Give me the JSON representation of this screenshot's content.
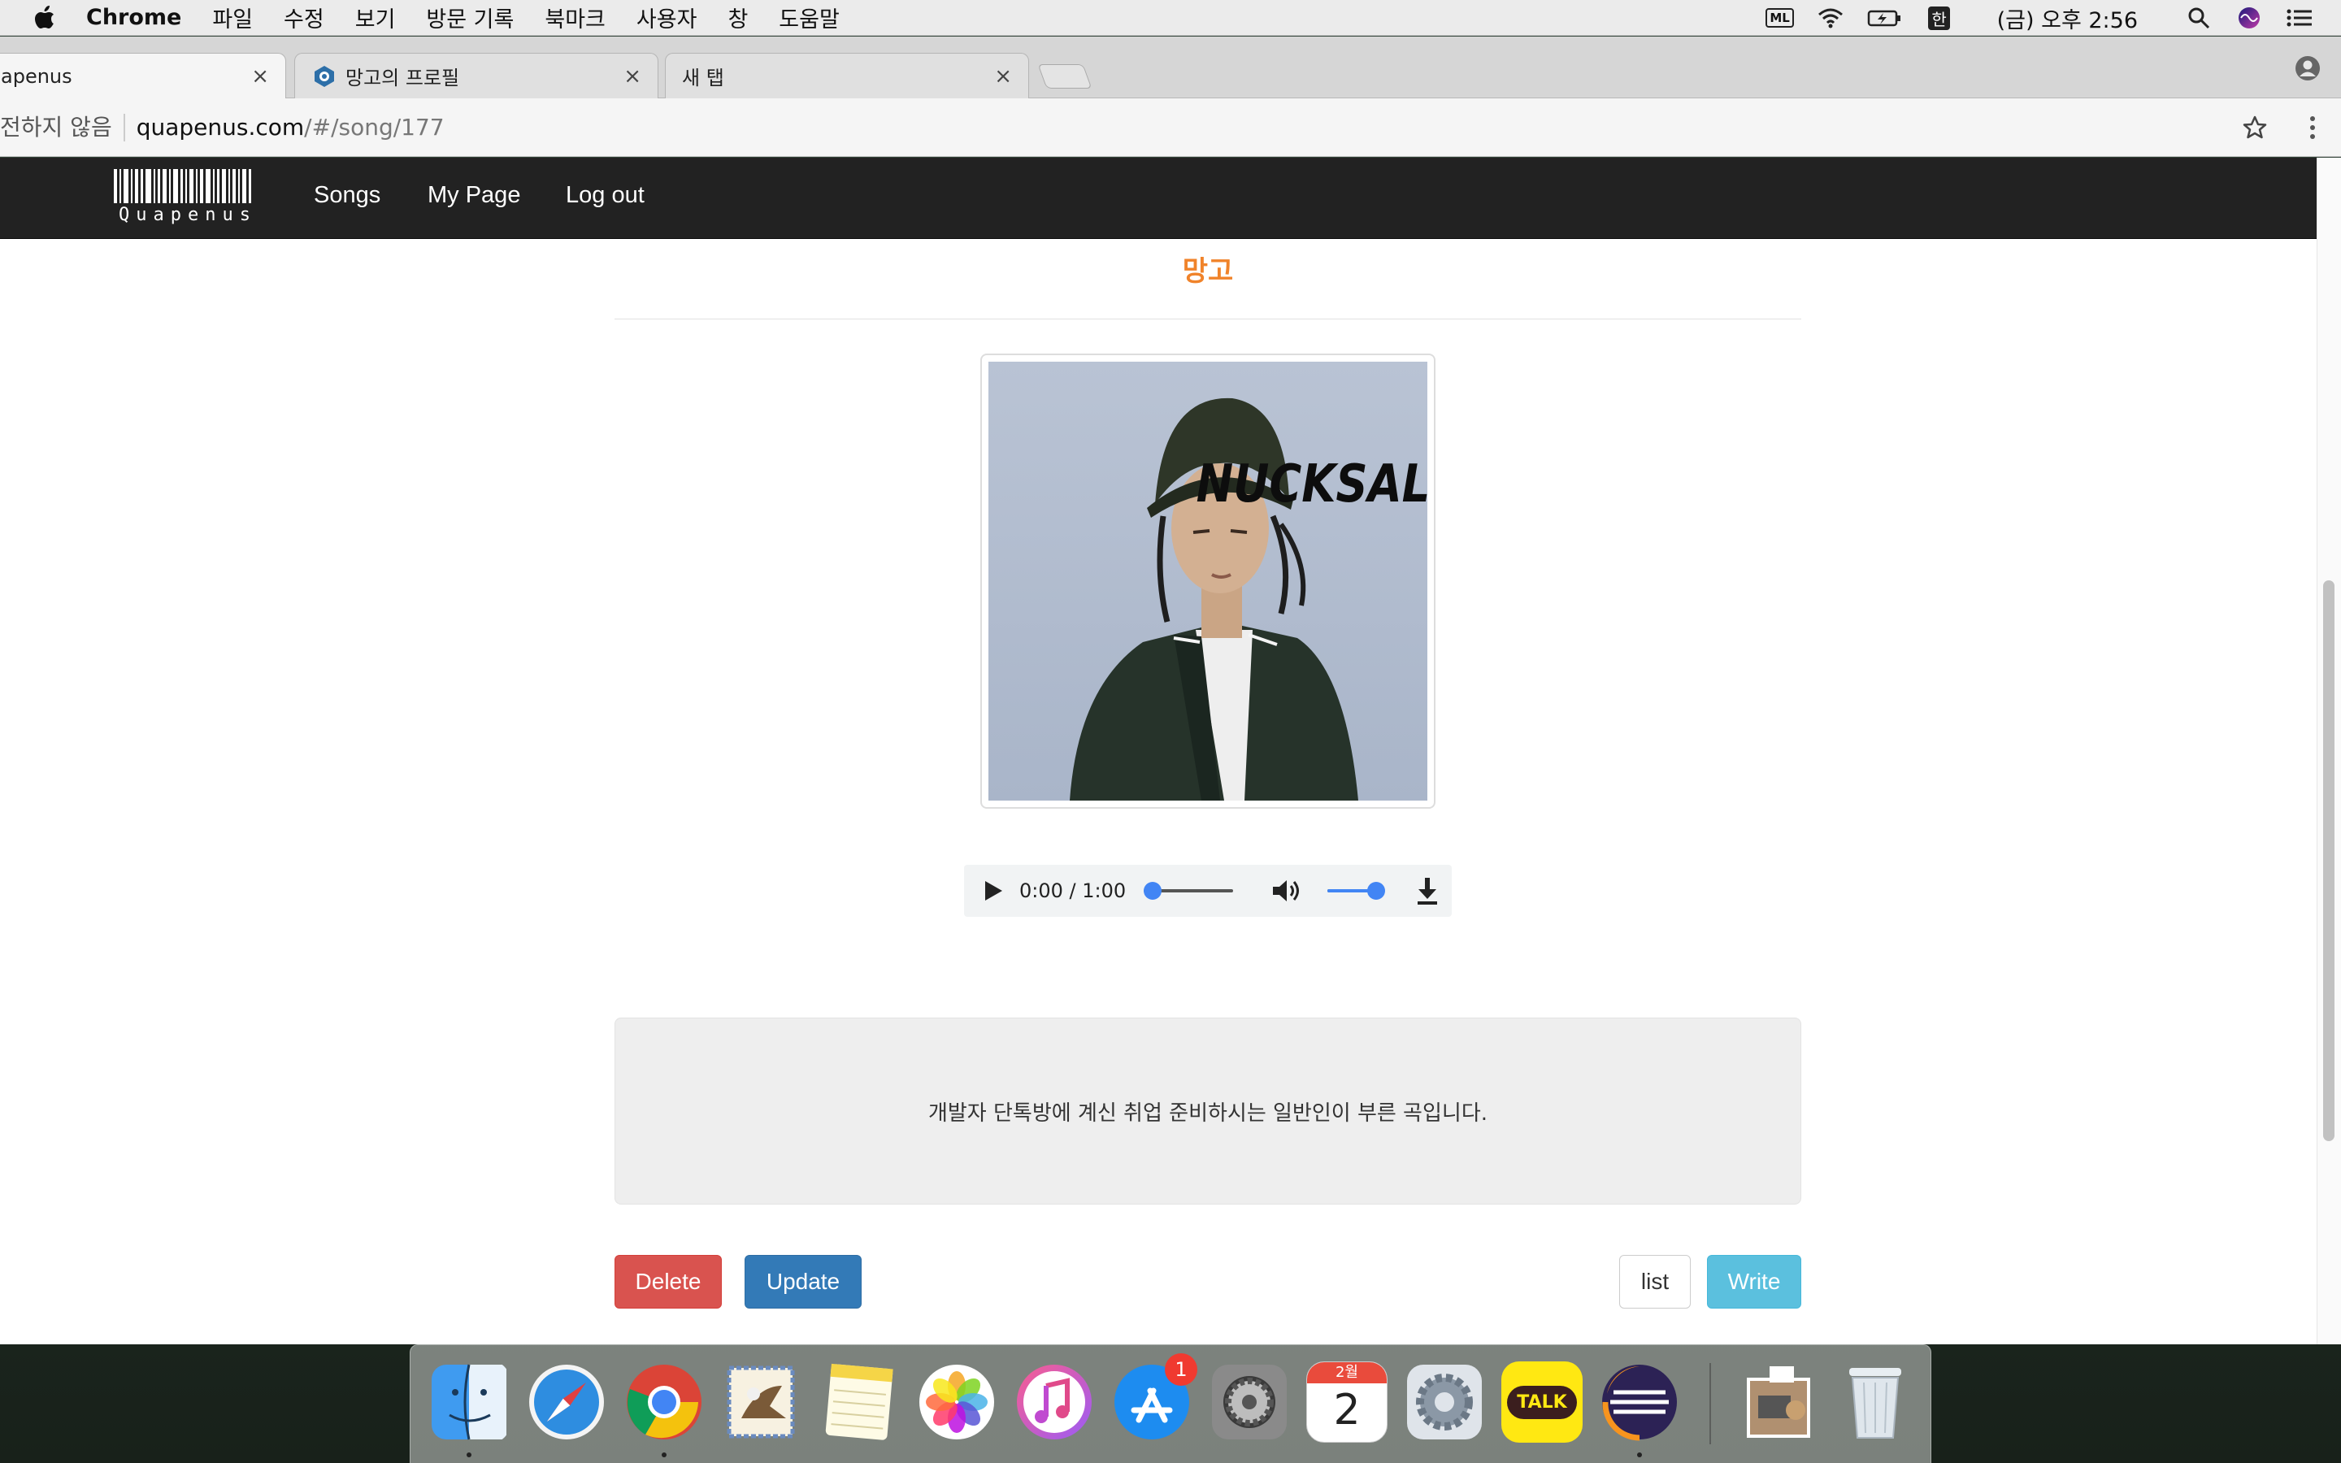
{
  "menubar": {
    "app_name": "Chrome",
    "items": [
      "파일",
      "수정",
      "보기",
      "방문 기록",
      "북마크",
      "사용자",
      "창",
      "도움말"
    ],
    "ml_label": "ML",
    "input_method": "한",
    "clock": "(금) 오후 2:56"
  },
  "tabs": [
    {
      "label": "apenus",
      "active": true
    },
    {
      "label": "망고의 프로필",
      "active": false
    },
    {
      "label": "새 탭",
      "active": false
    }
  ],
  "address": {
    "secure_note": "전하지 않음",
    "host": "quapenus.com",
    "path": "/#/song/177"
  },
  "navbar": {
    "brand": "Quapenus",
    "links": [
      "Songs",
      "My Page",
      "Log out"
    ]
  },
  "song": {
    "title": "망고",
    "description": "개발자 단톡방에 계신 취업 준비하시는 일반인이 부른 곡입니다.",
    "cover_text": "NUCKSAL"
  },
  "player": {
    "time": "0:00 / 1:00",
    "progress": 0.0,
    "volume": 1.0
  },
  "buttons": {
    "delete": "Delete",
    "update": "Update",
    "list": "list",
    "write": "Write"
  },
  "dock": {
    "calendar_month": "2월",
    "calendar_day": "2",
    "appstore_badge": "1",
    "kakao_label": "TALK"
  },
  "colors": {
    "title_accent": "#f0832a",
    "navbar_bg": "#222222",
    "danger": "#d9534f",
    "primary": "#337ab7",
    "info": "#5bc0de",
    "audio_accent": "#4285f4"
  }
}
